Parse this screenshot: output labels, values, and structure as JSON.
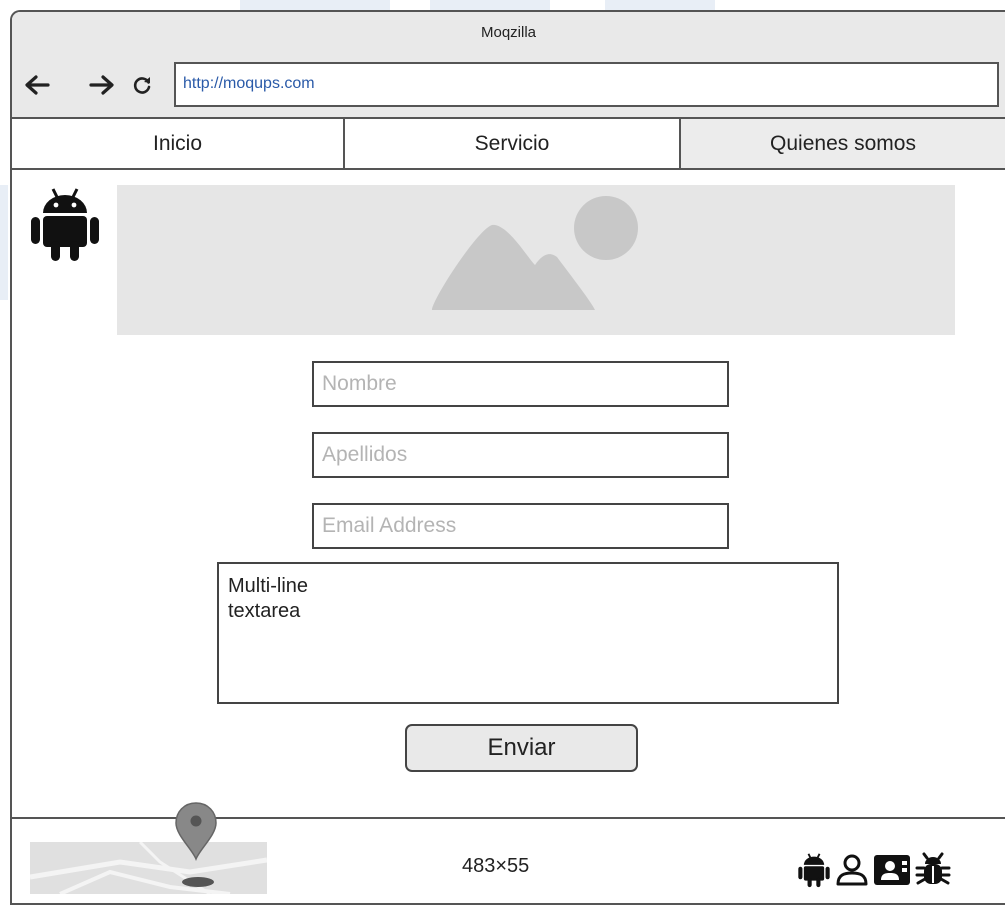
{
  "browser": {
    "title": "Moqzilla",
    "url": "http://moqups.com",
    "back_icon": "arrow-left-icon",
    "forward_icon": "arrow-right-icon",
    "reload_icon": "reload-icon"
  },
  "tabs": [
    {
      "label": "Inicio"
    },
    {
      "label": "Servicio"
    },
    {
      "label": "Quienes somos"
    }
  ],
  "header": {
    "logo_icon": "android-icon",
    "image_placeholder_icon": "image-placeholder-icon"
  },
  "form": {
    "nombre_placeholder": "Nombre",
    "apellidos_placeholder": "Apellidos",
    "email_placeholder": "Email Address",
    "textarea_text": "Multi-line\ntextarea",
    "submit_label": "Enviar"
  },
  "footer": {
    "map_icon": "map-pin-icon",
    "dimensions": "483×55",
    "icons": [
      "android-icon",
      "user-icon",
      "contact-card-icon",
      "bug-icon"
    ]
  },
  "colors": {
    "border": "#555555",
    "titlebar_bg": "#e9e9e9",
    "placeholder_bg": "#e6e6e6",
    "placeholder_shape": "#c8c8c8",
    "url_text": "#2a5aa8",
    "active_tab_bg": "#ececec"
  }
}
